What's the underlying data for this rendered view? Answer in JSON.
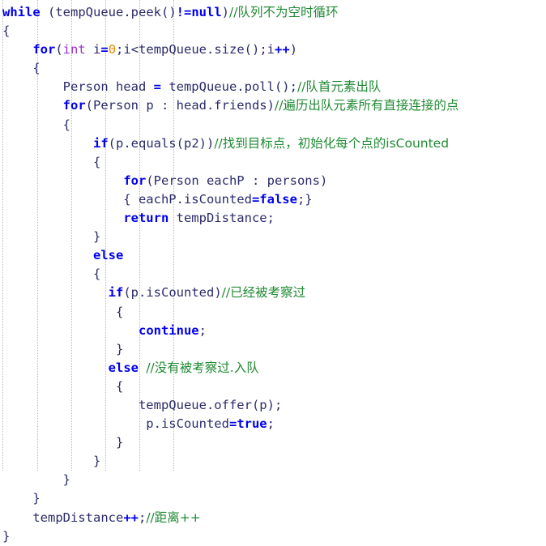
{
  "editor": {
    "language": "Java",
    "background_color": "#ffffff",
    "default_text_color": "#2b2b6b",
    "keyword_color": "#0000ee",
    "type_color": "#9b30c9",
    "number_color": "#ee8800",
    "comment_color": "#1f8a32",
    "indent_guide_color": "#b9b9b9",
    "indent_guide_positions": [
      3,
      46,
      88,
      130,
      172,
      214
    ]
  },
  "code": {
    "lines": [
      {
        "n": 1,
        "indent": 0,
        "text": "while (tempQueue.peek()!=null)//队列不为空时循环",
        "tokens": [
          {
            "t": "while",
            "c": "kw"
          },
          {
            "t": " (tempQueue.peek",
            "c": "id"
          },
          {
            "t": "()",
            "c": "pun"
          },
          {
            "t": "!=",
            "c": "op"
          },
          {
            "t": "null",
            "c": "kw"
          },
          {
            "t": ")",
            "c": "pun"
          },
          {
            "t": "//队列不为空时循环",
            "c": "cmt"
          }
        ]
      },
      {
        "n": 2,
        "indent": 0,
        "text": "{",
        "tokens": [
          {
            "t": "{",
            "c": "brc"
          }
        ]
      },
      {
        "n": 3,
        "indent": 4,
        "text": "    for(int i=0;i<tempQueue.size();i++)",
        "tokens": [
          {
            "t": "    ",
            "c": "id"
          },
          {
            "t": "for",
            "c": "kw"
          },
          {
            "t": "(",
            "c": "pun"
          },
          {
            "t": "int",
            "c": "typ"
          },
          {
            "t": " i",
            "c": "id"
          },
          {
            "t": "=",
            "c": "op"
          },
          {
            "t": "0",
            "c": "num"
          },
          {
            "t": ";i<tempQueue.size",
            "c": "id"
          },
          {
            "t": "()",
            "c": "pun"
          },
          {
            "t": ";i",
            "c": "id"
          },
          {
            "t": "++",
            "c": "op"
          },
          {
            "t": ")",
            "c": "pun"
          }
        ]
      },
      {
        "n": 4,
        "indent": 4,
        "text": "    {",
        "tokens": [
          {
            "t": "    {",
            "c": "brc"
          }
        ]
      },
      {
        "n": 5,
        "indent": 8,
        "text": "        Person head = tempQueue.poll();//队首元素出队",
        "tokens": [
          {
            "t": "        Person head ",
            "c": "id"
          },
          {
            "t": "=",
            "c": "op"
          },
          {
            "t": " tempQueue.poll",
            "c": "id"
          },
          {
            "t": "()",
            "c": "pun"
          },
          {
            "t": ";",
            "c": "id"
          },
          {
            "t": "//队首元素出队",
            "c": "cmt"
          }
        ]
      },
      {
        "n": 6,
        "indent": 8,
        "text": "        for(Person p : head.friends)//遍历出队元素所有直接连接的点",
        "tokens": [
          {
            "t": "        ",
            "c": "id"
          },
          {
            "t": "for",
            "c": "kw"
          },
          {
            "t": "(",
            "c": "pun"
          },
          {
            "t": "Person p : head.friends",
            "c": "id"
          },
          {
            "t": ")",
            "c": "pun"
          },
          {
            "t": "//遍历出队元素所有直接连接的点",
            "c": "cmt"
          }
        ]
      },
      {
        "n": 7,
        "indent": 8,
        "text": "        {",
        "tokens": [
          {
            "t": "        {",
            "c": "brc"
          }
        ]
      },
      {
        "n": 8,
        "indent": 12,
        "text": "            if(p.equals(p2))//找到目标点，初始化每个点的isCounted",
        "tokens": [
          {
            "t": "            ",
            "c": "id"
          },
          {
            "t": "if",
            "c": "kw"
          },
          {
            "t": "(p.equals",
            "c": "id"
          },
          {
            "t": "(p2)",
            "c": "pun"
          },
          {
            "t": ")",
            "c": "pun"
          },
          {
            "t": "//找到目标点，初始化每个点的isCounted",
            "c": "cmt"
          }
        ]
      },
      {
        "n": 9,
        "indent": 12,
        "text": "            {",
        "tokens": [
          {
            "t": "            {",
            "c": "brc"
          }
        ]
      },
      {
        "n": 10,
        "indent": 16,
        "text": "                for(Person eachP : persons)",
        "tokens": [
          {
            "t": "                ",
            "c": "id"
          },
          {
            "t": "for",
            "c": "kw"
          },
          {
            "t": "(",
            "c": "pun"
          },
          {
            "t": "Person eachP : persons",
            "c": "id"
          },
          {
            "t": ")",
            "c": "pun"
          }
        ]
      },
      {
        "n": 11,
        "indent": 16,
        "text": "                { eachP.isCounted=false;}",
        "tokens": [
          {
            "t": "                { eachP.isCounted",
            "c": "id"
          },
          {
            "t": "=",
            "c": "op"
          },
          {
            "t": "false",
            "c": "kw"
          },
          {
            "t": ";}",
            "c": "id"
          }
        ]
      },
      {
        "n": 12,
        "indent": 16,
        "text": "                return tempDistance;",
        "tokens": [
          {
            "t": "                ",
            "c": "id"
          },
          {
            "t": "return",
            "c": "kw"
          },
          {
            "t": " tempDistance;",
            "c": "id"
          }
        ]
      },
      {
        "n": 13,
        "indent": 12,
        "text": "            }",
        "tokens": [
          {
            "t": "            }",
            "c": "brc"
          }
        ]
      },
      {
        "n": 14,
        "indent": 12,
        "text": "            else",
        "tokens": [
          {
            "t": "            ",
            "c": "id"
          },
          {
            "t": "else",
            "c": "kw"
          }
        ]
      },
      {
        "n": 15,
        "indent": 12,
        "text": "            {",
        "tokens": [
          {
            "t": "            {",
            "c": "brc"
          }
        ]
      },
      {
        "n": 16,
        "indent": 14,
        "text": "              if(p.isCounted)//已经被考察过",
        "tokens": [
          {
            "t": "              ",
            "c": "id"
          },
          {
            "t": "if",
            "c": "kw"
          },
          {
            "t": "(p.isCounted",
            "c": "id"
          },
          {
            "t": ")",
            "c": "pun"
          },
          {
            "t": "//已经被考察过",
            "c": "cmt"
          }
        ]
      },
      {
        "n": 17,
        "indent": 15,
        "text": "               {",
        "tokens": [
          {
            "t": "               {",
            "c": "brc"
          }
        ]
      },
      {
        "n": 18,
        "indent": 18,
        "text": "                  continue;",
        "tokens": [
          {
            "t": "                  ",
            "c": "id"
          },
          {
            "t": "continue",
            "c": "kw"
          },
          {
            "t": ";",
            "c": "id"
          }
        ]
      },
      {
        "n": 19,
        "indent": 15,
        "text": "               }",
        "tokens": [
          {
            "t": "               }",
            "c": "brc"
          }
        ]
      },
      {
        "n": 20,
        "indent": 14,
        "text": "              else //没有被考察过.入队",
        "tokens": [
          {
            "t": "              ",
            "c": "id"
          },
          {
            "t": "else",
            "c": "kw"
          },
          {
            "t": " ",
            "c": "id"
          },
          {
            "t": "//没有被考察过.入队",
            "c": "cmt"
          }
        ]
      },
      {
        "n": 21,
        "indent": 15,
        "text": "               {",
        "tokens": [
          {
            "t": "               {",
            "c": "brc"
          }
        ]
      },
      {
        "n": 22,
        "indent": 18,
        "text": "                  tempQueue.offer(p);",
        "tokens": [
          {
            "t": "                  tempQueue.offer",
            "c": "id"
          },
          {
            "t": "(p)",
            "c": "pun"
          },
          {
            "t": ";",
            "c": "id"
          }
        ]
      },
      {
        "n": 23,
        "indent": 19,
        "text": "                   p.isCounted=true;",
        "tokens": [
          {
            "t": "                   p.isCounted",
            "c": "id"
          },
          {
            "t": "=",
            "c": "op"
          },
          {
            "t": "true",
            "c": "kw"
          },
          {
            "t": ";",
            "c": "id"
          }
        ]
      },
      {
        "n": 24,
        "indent": 15,
        "text": "               }",
        "tokens": [
          {
            "t": "               }",
            "c": "brc"
          }
        ]
      },
      {
        "n": 25,
        "indent": 12,
        "text": "            }",
        "tokens": [
          {
            "t": "            }",
            "c": "brc"
          }
        ]
      },
      {
        "n": 26,
        "indent": 8,
        "text": "        }",
        "tokens": [
          {
            "t": "        }",
            "c": "brc"
          }
        ]
      },
      {
        "n": 27,
        "indent": 4,
        "text": "    }",
        "tokens": [
          {
            "t": "    }",
            "c": "brc"
          }
        ]
      },
      {
        "n": 28,
        "indent": 4,
        "text": "    tempDistance++;//距离++",
        "tokens": [
          {
            "t": "    tempDistance",
            "c": "id"
          },
          {
            "t": "++",
            "c": "op"
          },
          {
            "t": ";",
            "c": "id"
          },
          {
            "t": "//距离++",
            "c": "cmt"
          }
        ]
      },
      {
        "n": 29,
        "indent": 0,
        "text": "}",
        "tokens": [
          {
            "t": "}",
            "c": "brc"
          }
        ]
      }
    ]
  }
}
